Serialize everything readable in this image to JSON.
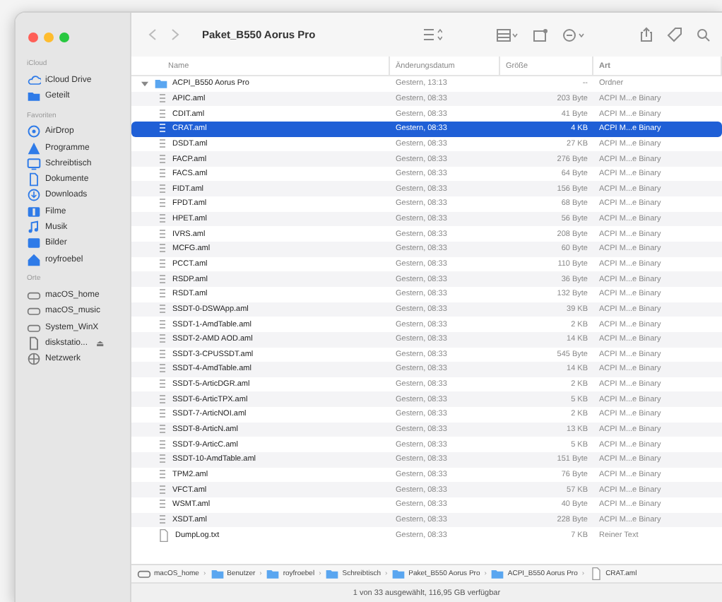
{
  "window": {
    "title": "Paket_B550 Aorus Pro"
  },
  "sidebar": {
    "sections": [
      {
        "heading": "iCloud",
        "items": [
          {
            "label": "iCloud Drive",
            "kind": "cloud"
          },
          {
            "label": "Geteilt",
            "kind": "folder"
          }
        ]
      },
      {
        "heading": "Favoriten",
        "items": [
          {
            "label": "AirDrop",
            "kind": "airdrop"
          },
          {
            "label": "Programme",
            "kind": "apps"
          },
          {
            "label": "Schreibtisch",
            "kind": "desktop"
          },
          {
            "label": "Dokumente",
            "kind": "doc"
          },
          {
            "label": "Downloads",
            "kind": "download"
          },
          {
            "label": "Filme",
            "kind": "film"
          },
          {
            "label": "Musik",
            "kind": "music"
          },
          {
            "label": "Bilder",
            "kind": "photo"
          },
          {
            "label": "royfroebel",
            "kind": "home"
          }
        ]
      },
      {
        "heading": "Orte",
        "items": [
          {
            "label": "macOS_home",
            "kind": "disk"
          },
          {
            "label": "macOS_music",
            "kind": "disk"
          },
          {
            "label": "System_WinX",
            "kind": "disk"
          },
          {
            "label": "diskstatio...",
            "kind": "server",
            "eject": "⏏"
          },
          {
            "label": "Netzwerk",
            "kind": "globe"
          }
        ]
      }
    ]
  },
  "table": {
    "columns": [
      "Name",
      "Änderungsdatum",
      "Größe",
      "Art"
    ],
    "rows": [
      {
        "kind": "folder",
        "name": "ACPI_B550 Aorus Pro",
        "date": "Gestern, 13:13",
        "size": "--",
        "type": "Ordner",
        "expanded": true,
        "selected": false,
        "children": [
          {
            "kind": "aml",
            "name": "APIC.aml",
            "date": "Gestern, 08:33",
            "size": "203 Byte",
            "type": "ACPI M...e Binary",
            "selected": false
          },
          {
            "kind": "aml",
            "name": "CDIT.aml",
            "date": "Gestern, 08:33",
            "size": "41 Byte",
            "type": "ACPI M...e Binary",
            "selected": false
          },
          {
            "kind": "aml",
            "name": "CRAT.aml",
            "date": "Gestern, 08:33",
            "size": "4 KB",
            "type": "ACPI M...e Binary",
            "selected": true
          },
          {
            "kind": "aml",
            "name": "DSDT.aml",
            "date": "Gestern, 08:33",
            "size": "27 KB",
            "type": "ACPI M...e Binary",
            "selected": false
          },
          {
            "kind": "aml",
            "name": "FACP.aml",
            "date": "Gestern, 08:33",
            "size": "276 Byte",
            "type": "ACPI M...e Binary",
            "selected": false
          },
          {
            "kind": "aml",
            "name": "FACS.aml",
            "date": "Gestern, 08:33",
            "size": "64 Byte",
            "type": "ACPI M...e Binary",
            "selected": false
          },
          {
            "kind": "aml",
            "name": "FIDT.aml",
            "date": "Gestern, 08:33",
            "size": "156 Byte",
            "type": "ACPI M...e Binary",
            "selected": false
          },
          {
            "kind": "aml",
            "name": "FPDT.aml",
            "date": "Gestern, 08:33",
            "size": "68 Byte",
            "type": "ACPI M...e Binary",
            "selected": false
          },
          {
            "kind": "aml",
            "name": "HPET.aml",
            "date": "Gestern, 08:33",
            "size": "56 Byte",
            "type": "ACPI M...e Binary",
            "selected": false
          },
          {
            "kind": "aml",
            "name": "IVRS.aml",
            "date": "Gestern, 08:33",
            "size": "208 Byte",
            "type": "ACPI M...e Binary",
            "selected": false
          },
          {
            "kind": "aml",
            "name": "MCFG.aml",
            "date": "Gestern, 08:33",
            "size": "60 Byte",
            "type": "ACPI M...e Binary",
            "selected": false
          },
          {
            "kind": "aml",
            "name": "PCCT.aml",
            "date": "Gestern, 08:33",
            "size": "110 Byte",
            "type": "ACPI M...e Binary",
            "selected": false
          },
          {
            "kind": "aml",
            "name": "RSDP.aml",
            "date": "Gestern, 08:33",
            "size": "36 Byte",
            "type": "ACPI M...e Binary",
            "selected": false
          },
          {
            "kind": "aml",
            "name": "RSDT.aml",
            "date": "Gestern, 08:33",
            "size": "132 Byte",
            "type": "ACPI M...e Binary",
            "selected": false
          },
          {
            "kind": "aml",
            "name": "SSDT-0-DSWApp.aml",
            "date": "Gestern, 08:33",
            "size": "39 KB",
            "type": "ACPI M...e Binary",
            "selected": false
          },
          {
            "kind": "aml",
            "name": "SSDT-1-AmdTable.aml",
            "date": "Gestern, 08:33",
            "size": "2 KB",
            "type": "ACPI M...e Binary",
            "selected": false
          },
          {
            "kind": "aml",
            "name": "SSDT-2-AMD AOD.aml",
            "date": "Gestern, 08:33",
            "size": "14 KB",
            "type": "ACPI M...e Binary",
            "selected": false
          },
          {
            "kind": "aml",
            "name": "SSDT-3-CPUSSDT.aml",
            "date": "Gestern, 08:33",
            "size": "545 Byte",
            "type": "ACPI M...e Binary",
            "selected": false
          },
          {
            "kind": "aml",
            "name": "SSDT-4-AmdTable.aml",
            "date": "Gestern, 08:33",
            "size": "14 KB",
            "type": "ACPI M...e Binary",
            "selected": false
          },
          {
            "kind": "aml",
            "name": "SSDT-5-ArticDGR.aml",
            "date": "Gestern, 08:33",
            "size": "2 KB",
            "type": "ACPI M...e Binary",
            "selected": false
          },
          {
            "kind": "aml",
            "name": "SSDT-6-ArticTPX.aml",
            "date": "Gestern, 08:33",
            "size": "5 KB",
            "type": "ACPI M...e Binary",
            "selected": false
          },
          {
            "kind": "aml",
            "name": "SSDT-7-ArticNOI.aml",
            "date": "Gestern, 08:33",
            "size": "2 KB",
            "type": "ACPI M...e Binary",
            "selected": false
          },
          {
            "kind": "aml",
            "name": "SSDT-8-ArticN.aml",
            "date": "Gestern, 08:33",
            "size": "13 KB",
            "type": "ACPI M...e Binary",
            "selected": false
          },
          {
            "kind": "aml",
            "name": "SSDT-9-ArticC.aml",
            "date": "Gestern, 08:33",
            "size": "5 KB",
            "type": "ACPI M...e Binary",
            "selected": false
          },
          {
            "kind": "aml",
            "name": "SSDT-10-AmdTable.aml",
            "date": "Gestern, 08:33",
            "size": "151 Byte",
            "type": "ACPI M...e Binary",
            "selected": false
          },
          {
            "kind": "aml",
            "name": "TPM2.aml",
            "date": "Gestern, 08:33",
            "size": "76 Byte",
            "type": "ACPI M...e Binary",
            "selected": false
          },
          {
            "kind": "aml",
            "name": "VFCT.aml",
            "date": "Gestern, 08:33",
            "size": "57 KB",
            "type": "ACPI M...e Binary",
            "selected": false
          },
          {
            "kind": "aml",
            "name": "WSMT.aml",
            "date": "Gestern, 08:33",
            "size": "40 Byte",
            "type": "ACPI M...e Binary",
            "selected": false
          },
          {
            "kind": "aml",
            "name": "XSDT.aml",
            "date": "Gestern, 08:33",
            "size": "228 Byte",
            "type": "ACPI M...e Binary",
            "selected": false
          },
          {
            "kind": "text",
            "name": "DumpLog.txt",
            "date": "Gestern, 08:33",
            "size": "7 KB",
            "type": "Reiner Text",
            "selected": false
          }
        ]
      }
    ]
  },
  "path_bar": [
    {
      "label": "macOS_home",
      "kind": "disk"
    },
    {
      "label": "Benutzer",
      "kind": "folder"
    },
    {
      "label": "royfroebel",
      "kind": "folder"
    },
    {
      "label": "Schreibtisch",
      "kind": "folder"
    },
    {
      "label": "Paket_B550 Aorus Pro",
      "kind": "folder"
    },
    {
      "label": "ACPI_B550 Aorus Pro",
      "kind": "folder"
    },
    {
      "label": "CRAT.aml",
      "kind": "file"
    }
  ],
  "path_separator": "›",
  "status_bar": "1 von 33 ausgewählt, 116,95 GB verfügbar"
}
